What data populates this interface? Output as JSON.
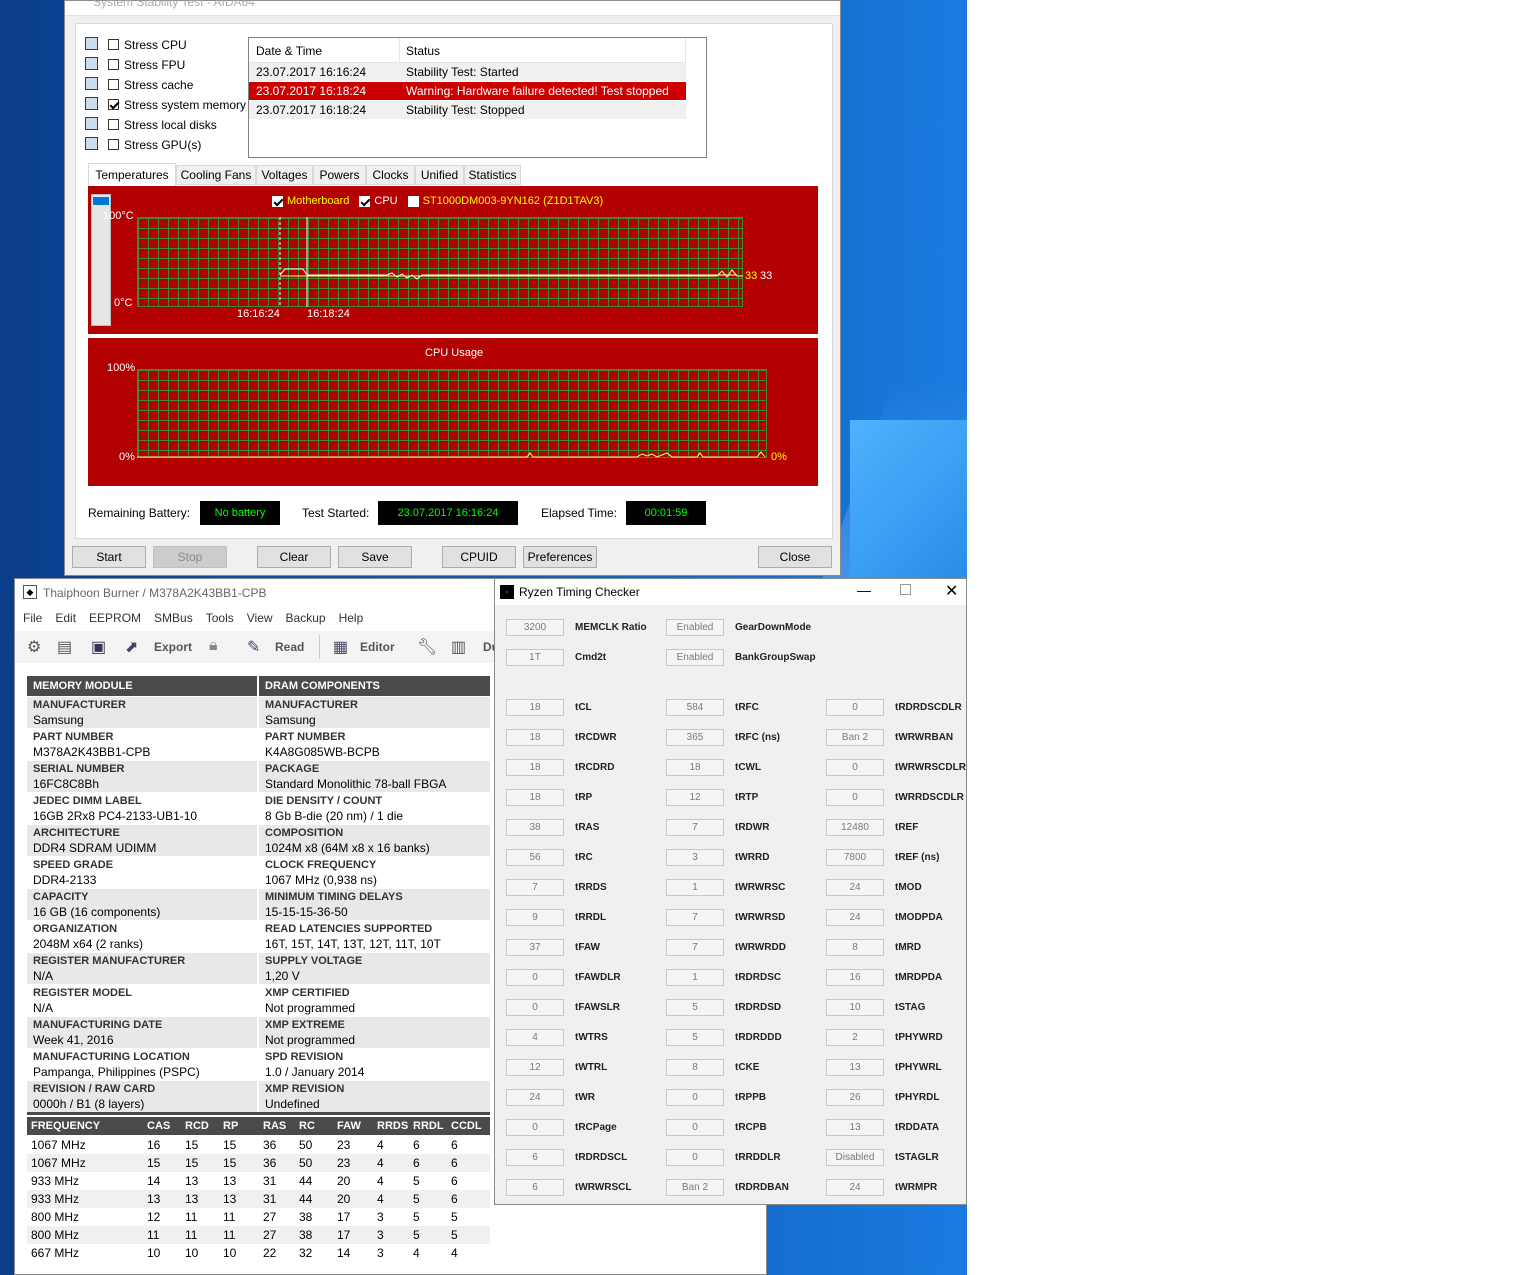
{
  "aida": {
    "title": "System Stability Test - AIDA64",
    "stress_items": [
      {
        "label": "Stress CPU",
        "checked": false,
        "icon": "cpu-chip-icon"
      },
      {
        "label": "Stress FPU",
        "checked": false,
        "icon": "fpu-icon"
      },
      {
        "label": "Stress cache",
        "checked": false,
        "icon": "cache-icon"
      },
      {
        "label": "Stress system memory",
        "checked": true,
        "icon": "memory-stick-icon"
      },
      {
        "label": "Stress local disks",
        "checked": false,
        "icon": "disk-drive-icon"
      },
      {
        "label": "Stress GPU(s)",
        "checked": false,
        "icon": "monitor-icon"
      }
    ],
    "log_headers": [
      "Date & Time",
      "Status"
    ],
    "log_rows": [
      {
        "time": "23.07.2017 16:16:24",
        "status": "Stability Test: Started",
        "warn": false
      },
      {
        "time": "23.07.2017 16:18:24",
        "status": "Warning: Hardware failure detected! Test stopped",
        "warn": true
      },
      {
        "time": "23.07.2017 16:18:24",
        "status": "Stability Test: Stopped",
        "warn": false
      }
    ],
    "tabs": [
      "Temperatures",
      "Cooling Fans",
      "Voltages",
      "Powers",
      "Clocks",
      "Unified",
      "Statistics"
    ],
    "active_tab": "Temperatures",
    "temp_legend": [
      {
        "label": "Motherboard",
        "checked": true,
        "color": "#ffff00"
      },
      {
        "label": "CPU",
        "checked": true,
        "color": "#ffffff"
      },
      {
        "label": "ST1000DM003-9YN162 (Z1D1TAV3)",
        "checked": false,
        "color": "#ffff00"
      }
    ],
    "temp_y_top": "100°C",
    "temp_y_bottom": "0°C",
    "temp_x_labels": [
      "16:16:24",
      "16:18:24"
    ],
    "temp_value_a": "33",
    "temp_value_b": "33",
    "cpu_title": "CPU Usage",
    "cpu_y_top": "100%",
    "cpu_y_bottom": "0%",
    "cpu_value": "0%",
    "battery_label": "Remaining Battery:",
    "battery_value": "No battery",
    "started_label": "Test Started:",
    "started_value": "23.07.2017 16:16:24",
    "elapsed_label": "Elapsed Time:",
    "elapsed_value": "00:01:59",
    "buttons": {
      "start": "Start",
      "stop": "Stop",
      "clear": "Clear",
      "save": "Save",
      "cpuid": "CPUID",
      "preferences": "Preferences",
      "close": "Close"
    },
    "colors": {
      "graph_red": "#b30000",
      "grid_green": "#3a8a3a",
      "warn_red": "#cc0000",
      "status_green": "#00ff00"
    }
  },
  "thaiphoon": {
    "title": "Thaiphoon Burner / M378A2K43BB1-CPB",
    "menu": [
      "File",
      "Edit",
      "EEPROM",
      "SMBus",
      "Tools",
      "View",
      "Backup",
      "Help"
    ],
    "toolbar": {
      "export": "Export",
      "read": "Read",
      "editor": "Editor",
      "dump": "Du"
    },
    "col_headers": [
      "MEMORY MODULE",
      "DRAM COMPONENTS"
    ],
    "left": [
      {
        "label": "MANUFACTURER",
        "value": "Samsung"
      },
      {
        "label": "PART NUMBER",
        "value": "M378A2K43BB1-CPB"
      },
      {
        "label": "SERIAL NUMBER",
        "value": "16FC8C8Bh"
      },
      {
        "label": "JEDEC DIMM LABEL",
        "value": "16GB 2Rx8 PC4-2133-UB1-10"
      },
      {
        "label": "ARCHITECTURE",
        "value": "DDR4 SDRAM UDIMM"
      },
      {
        "label": "SPEED GRADE",
        "value": "DDR4-2133"
      },
      {
        "label": "CAPACITY",
        "value": "16 GB (16 components)"
      },
      {
        "label": "ORGANIZATION",
        "value": "2048M x64 (2 ranks)"
      },
      {
        "label": "REGISTER MANUFACTURER",
        "value": "N/A"
      },
      {
        "label": "REGISTER MODEL",
        "value": "N/A"
      },
      {
        "label": "MANUFACTURING DATE",
        "value": "Week 41, 2016"
      },
      {
        "label": "MANUFACTURING LOCATION",
        "value": "Pampanga, Philippines (PSPC)"
      },
      {
        "label": "REVISION / RAW CARD",
        "value": "0000h / B1 (8 layers)"
      }
    ],
    "right": [
      {
        "label": "MANUFACTURER",
        "value": "Samsung"
      },
      {
        "label": "PART NUMBER",
        "value": "K4A8G085WB-BCPB"
      },
      {
        "label": "PACKAGE",
        "value": "Standard Monolithic 78-ball FBGA"
      },
      {
        "label": "DIE DENSITY / COUNT",
        "value": "8 Gb B-die (20 nm) / 1 die"
      },
      {
        "label": "COMPOSITION",
        "value": "1024M x8 (64M x8 x 16 banks)"
      },
      {
        "label": "CLOCK FREQUENCY",
        "value": "1067 MHz (0,938 ns)"
      },
      {
        "label": "MINIMUM TIMING DELAYS",
        "value": "15-15-15-36-50"
      },
      {
        "label": "READ LATENCIES SUPPORTED",
        "value": "16T, 15T, 14T, 13T, 12T, 11T, 10T"
      },
      {
        "label": "SUPPLY VOLTAGE",
        "value": "1,20 V"
      },
      {
        "label": "XMP CERTIFIED",
        "value": "Not programmed"
      },
      {
        "label": "XMP EXTREME",
        "value": "Not programmed"
      },
      {
        "label": "SPD REVISION",
        "value": "1.0 / January 2014"
      },
      {
        "label": "XMP REVISION",
        "value": "Undefined"
      }
    ],
    "freq_headers": [
      "FREQUENCY",
      "CAS",
      "RCD",
      "RP",
      "RAS",
      "RC",
      "FAW",
      "RRDS",
      "RRDL",
      "CCDL"
    ],
    "freq_rows": [
      [
        "1067 MHz",
        "16",
        "15",
        "15",
        "36",
        "50",
        "23",
        "4",
        "6",
        "6"
      ],
      [
        "1067 MHz",
        "15",
        "15",
        "15",
        "36",
        "50",
        "23",
        "4",
        "6",
        "6"
      ],
      [
        "933 MHz",
        "14",
        "13",
        "13",
        "31",
        "44",
        "20",
        "4",
        "5",
        "6"
      ],
      [
        "933 MHz",
        "13",
        "13",
        "13",
        "31",
        "44",
        "20",
        "4",
        "5",
        "6"
      ],
      [
        "800 MHz",
        "12",
        "11",
        "11",
        "27",
        "38",
        "17",
        "3",
        "5",
        "5"
      ],
      [
        "800 MHz",
        "11",
        "11",
        "11",
        "27",
        "38",
        "17",
        "3",
        "5",
        "5"
      ],
      [
        "667 MHz",
        "10",
        "10",
        "10",
        "22",
        "32",
        "14",
        "3",
        "4",
        "4"
      ]
    ]
  },
  "rtc": {
    "title": "Ryzen Timing Checker",
    "top": [
      {
        "value": "3200",
        "label": "MEMCLK Ratio",
        "value2": "Enabled",
        "label2": "GearDownMode"
      },
      {
        "value": "1T",
        "label": "Cmd2t",
        "value2": "Enabled",
        "label2": "BankGroupSwap"
      }
    ],
    "grid": [
      [
        {
          "v": "18",
          "l": "tCL"
        },
        {
          "v": "584",
          "l": "tRFC"
        },
        {
          "v": "0",
          "l": "tRDRDSCDLR"
        }
      ],
      [
        {
          "v": "18",
          "l": "tRCDWR"
        },
        {
          "v": "365",
          "l": "tRFC (ns)"
        },
        {
          "v": "Ban 2",
          "l": "tWRWRBAN"
        }
      ],
      [
        {
          "v": "18",
          "l": "tRCDRD"
        },
        {
          "v": "18",
          "l": "tCWL"
        },
        {
          "v": "0",
          "l": "tWRWRSCDLR"
        }
      ],
      [
        {
          "v": "18",
          "l": "tRP"
        },
        {
          "v": "12",
          "l": "tRTP"
        },
        {
          "v": "0",
          "l": "tWRRDSCDLR"
        }
      ],
      [
        {
          "v": "38",
          "l": "tRAS"
        },
        {
          "v": "7",
          "l": "tRDWR"
        },
        {
          "v": "12480",
          "l": "tREF"
        }
      ],
      [
        {
          "v": "56",
          "l": "tRC"
        },
        {
          "v": "3",
          "l": "tWRRD"
        },
        {
          "v": "7800",
          "l": "tREF (ns)"
        }
      ],
      [
        {
          "v": "7",
          "l": "tRRDS"
        },
        {
          "v": "1",
          "l": "tWRWRSC"
        },
        {
          "v": "24",
          "l": "tMOD"
        }
      ],
      [
        {
          "v": "9",
          "l": "tRRDL"
        },
        {
          "v": "7",
          "l": "tWRWRSD"
        },
        {
          "v": "24",
          "l": "tMODPDA"
        }
      ],
      [
        {
          "v": "37",
          "l": "tFAW"
        },
        {
          "v": "7",
          "l": "tWRWRDD"
        },
        {
          "v": "8",
          "l": "tMRD"
        }
      ],
      [
        {
          "v": "0",
          "l": "tFAWDLR"
        },
        {
          "v": "1",
          "l": "tRDRDSC"
        },
        {
          "v": "16",
          "l": "tMRDPDA"
        }
      ],
      [
        {
          "v": "0",
          "l": "tFAWSLR"
        },
        {
          "v": "5",
          "l": "tRDRDSD"
        },
        {
          "v": "10",
          "l": "tSTAG"
        }
      ],
      [
        {
          "v": "4",
          "l": "tWTRS"
        },
        {
          "v": "5",
          "l": "tRDRDDD"
        },
        {
          "v": "2",
          "l": "tPHYWRD"
        }
      ],
      [
        {
          "v": "12",
          "l": "tWTRL"
        },
        {
          "v": "8",
          "l": "tCKE"
        },
        {
          "v": "13",
          "l": "tPHYWRL"
        }
      ],
      [
        {
          "v": "24",
          "l": "tWR"
        },
        {
          "v": "0",
          "l": "tRPPB"
        },
        {
          "v": "26",
          "l": "tPHYRDL"
        }
      ],
      [
        {
          "v": "0",
          "l": "tRCPage"
        },
        {
          "v": "0",
          "l": "tRCPB"
        },
        {
          "v": "13",
          "l": "tRDDATA"
        }
      ],
      [
        {
          "v": "6",
          "l": "tRDRDSCL"
        },
        {
          "v": "0",
          "l": "tRRDDLR"
        },
        {
          "v": "Disabled",
          "l": "tSTAGLR"
        }
      ],
      [
        {
          "v": "6",
          "l": "tWRWRSCL"
        },
        {
          "v": "Ban 2",
          "l": "tRDRDBAN"
        },
        {
          "v": "24",
          "l": "tWRMPR"
        }
      ]
    ]
  }
}
